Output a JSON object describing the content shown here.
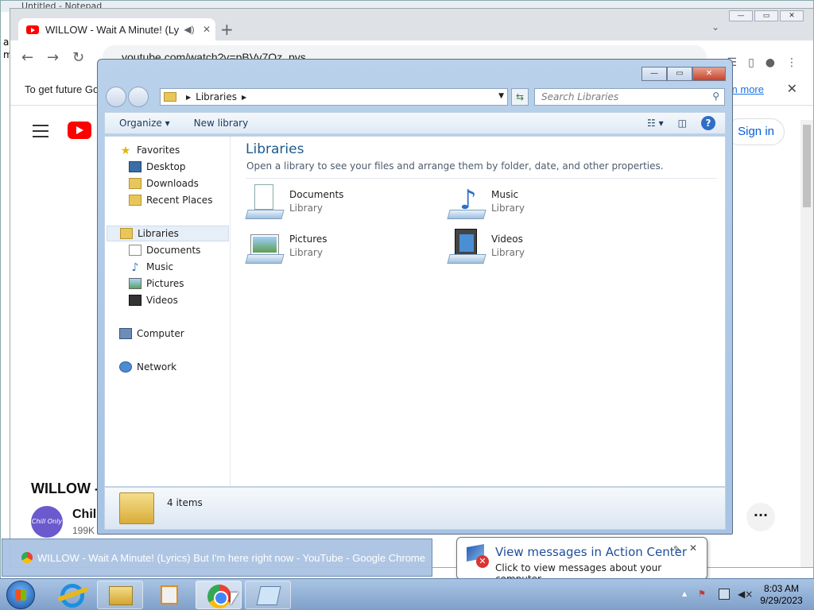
{
  "notepad": {
    "title": "Untitled - Notepad",
    "text_lines": [
      "a",
      "m"
    ]
  },
  "chrome": {
    "tab_title": "WILLOW - Wait A Minute! (Ly",
    "url": "youtube.com/watch?v=pBVy7Oz_pys",
    "infobar_text": "To get future Go",
    "learn_more": "rn more",
    "page": {
      "sign_in": "Sign in",
      "video_title": "WILLOW -",
      "channel": "Chill",
      "subscribers": "199K",
      "avatar_text": "Chill Only"
    }
  },
  "explorer": {
    "breadcrumb": "Libraries",
    "search_placeholder": "Search Libraries",
    "commands": {
      "organize": "Organize ▾",
      "new_library": "New library"
    },
    "nav": {
      "favorites": "Favorites",
      "desktop": "Desktop",
      "downloads": "Downloads",
      "recent": "Recent Places",
      "libraries": "Libraries",
      "documents": "Documents",
      "music": "Music",
      "pictures": "Pictures",
      "videos": "Videos",
      "computer": "Computer",
      "network": "Network"
    },
    "content": {
      "title": "Libraries",
      "description": "Open a library to see your files and arrange them by folder, date, and other properties.",
      "libraries": [
        {
          "name": "Documents",
          "sub": "Library"
        },
        {
          "name": "Music",
          "sub": "Library"
        },
        {
          "name": "Pictures",
          "sub": "Library"
        },
        {
          "name": "Videos",
          "sub": "Library"
        }
      ]
    },
    "details": {
      "count": "4 items"
    }
  },
  "taskbar": {
    "preview_title": "WILLOW - Wait A Minute! (Lyrics) But I'm here right now - YouTube - Google Chrome",
    "clock_time": "8:03 AM",
    "clock_date": "9/29/2023"
  },
  "balloon": {
    "title": "View messages in Action Center",
    "text": "Click to view messages about your computer."
  }
}
